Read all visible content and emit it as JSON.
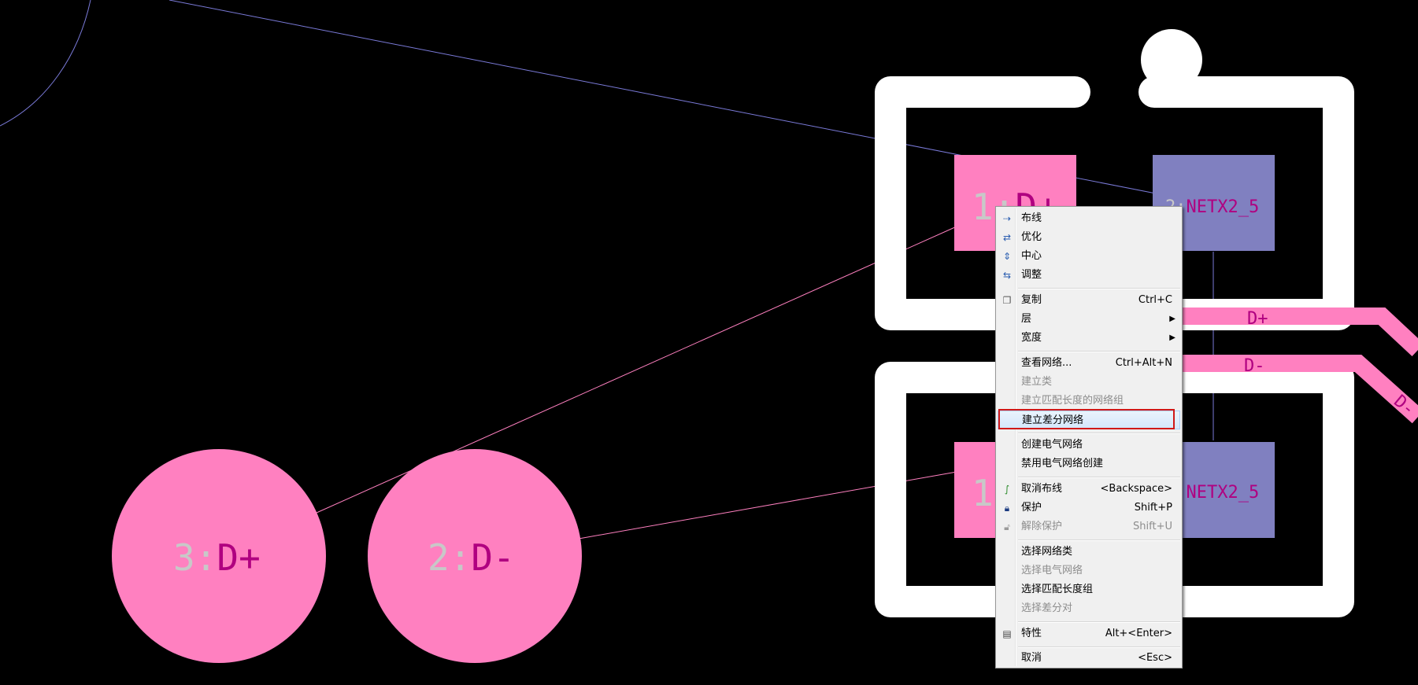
{
  "canvas": {
    "colors": {
      "background": "#000000",
      "pad_top_layer": "#ff80c0",
      "pad_purple": "#8080c0",
      "silkscreen": "#ffffff",
      "ratsnest_blue": "#7a7ad8",
      "ratsnest_pink": "#ff80c0",
      "pad_name": "#b00080",
      "pad_number": "#c8c8c8"
    },
    "pads": [
      {
        "number": "1:",
        "net": "D+"
      },
      {
        "number": "2:",
        "net": "NETX2_5"
      },
      {
        "number": "1:",
        "net": ""
      },
      {
        "number": "2:",
        "net": "NETX2_5"
      },
      {
        "number": "3:",
        "net": "D+"
      },
      {
        "number": "2:",
        "net": "D-"
      }
    ],
    "trace_labels": [
      "D+",
      "D-",
      "D-"
    ]
  },
  "context_menu": {
    "items": [
      {
        "label": "布线",
        "icon": "route-icon",
        "enabled": true
      },
      {
        "label": "优化",
        "icon": "optimize-icon",
        "enabled": true
      },
      {
        "label": "中心",
        "icon": "center-icon",
        "enabled": true
      },
      {
        "label": "调整",
        "icon": "adjust-icon",
        "enabled": true
      },
      {
        "label": "复制",
        "shortcut": "Ctrl+C",
        "icon": "copy-icon",
        "enabled": true
      },
      {
        "label": "层",
        "submenu": true,
        "enabled": true
      },
      {
        "label": "宽度",
        "submenu": true,
        "enabled": true
      },
      {
        "label": "查看网络...",
        "shortcut": "Ctrl+Alt+N",
        "enabled": true
      },
      {
        "label": "建立类",
        "enabled": false
      },
      {
        "label": "建立匹配长度的网络组",
        "enabled": false
      },
      {
        "label": "建立差分网络",
        "enabled": true,
        "highlighted": true
      },
      {
        "label": "创建电气网络",
        "enabled": true
      },
      {
        "label": "禁用电气网络创建",
        "enabled": true
      },
      {
        "label": "取消布线",
        "shortcut": "<Backspace>",
        "icon": "unroute-icon",
        "enabled": true
      },
      {
        "label": "保护",
        "shortcut": "Shift+P",
        "icon": "lock-icon",
        "enabled": true
      },
      {
        "label": "解除保护",
        "shortcut": "Shift+U",
        "icon": "unlock-icon",
        "enabled": false
      },
      {
        "label": "选择网络类",
        "enabled": true
      },
      {
        "label": "选择电气网络",
        "enabled": false
      },
      {
        "label": "选择匹配长度组",
        "enabled": true
      },
      {
        "label": "选择差分对",
        "enabled": false
      },
      {
        "label": "特性",
        "shortcut": "Alt+<Enter>",
        "icon": "properties-icon",
        "enabled": true
      },
      {
        "label": "取消",
        "shortcut": "<Esc>",
        "enabled": true
      }
    ]
  }
}
